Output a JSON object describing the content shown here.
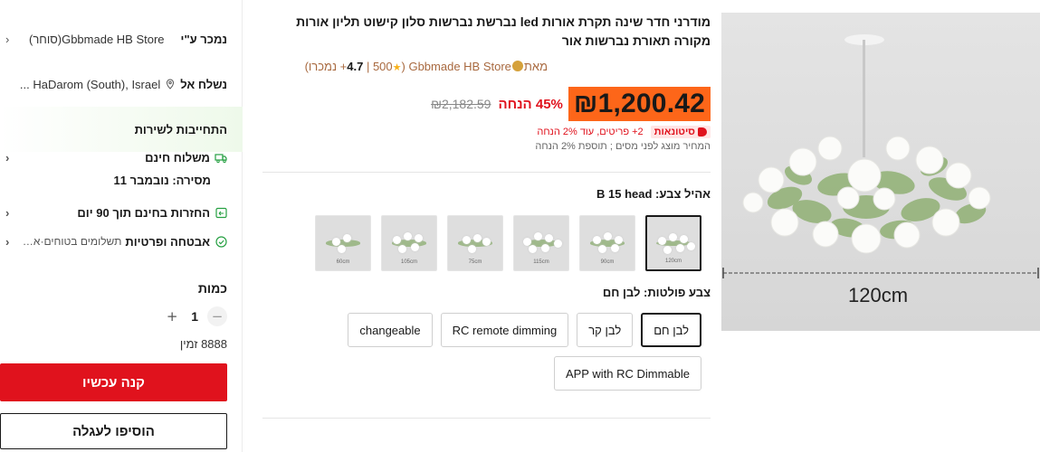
{
  "left": {
    "seller_label": "נמכר ע\"י",
    "seller_store": "Gbbmade HB Store(סוחר)",
    "ship_label": "נשלח אל",
    "ship_location": "HaDarom (South), Israel ...",
    "service_title": "התחייבות לשירות",
    "free_shipping": "משלוח חינם",
    "delivery": "מסירה: נובמבר 11",
    "returns": "החזרות בחינם תוך 90 יום",
    "security_title": "אבטחה ופרטיות",
    "security_sub": "תשלומים בטוחים·אבט...",
    "quantity_label": "כמות",
    "quantity_value": "1",
    "qty_minus": "−",
    "qty_plus": "+",
    "stock": "8888 זמין",
    "buy_now": "קנה עכשיו",
    "add_to_cart": "הוסיפו לעגלה",
    "chevron": "‹"
  },
  "product": {
    "title": "מודרני חדר שינה תקרת אורות led נברשת נברשות סלון קישוט תליון אורות מקורה תאורת נברשות אור",
    "store_name": "Gbbmade HB Store",
    "store_suffix": "מאת",
    "rating": "4.7",
    "sold": "500+ נמכרו",
    "price": "₪1,200.42",
    "discount": "45% הנחה",
    "original_price": "₪2,182.59",
    "promo_badge": "סיטונאות",
    "promo_text": "2+ פריטים, עוד 2% הנחה",
    "tax_note": "המחיר מוצג לפני מסים ; תוספת 2% הנחה",
    "color_label": "אהיל צבע: B 15 head",
    "thumbnails": [
      {
        "caption": "120cm",
        "selected": true
      },
      {
        "caption": "90cm",
        "selected": false
      },
      {
        "caption": "115cm",
        "selected": false
      },
      {
        "caption": "75cm",
        "selected": false
      },
      {
        "caption": "105cm",
        "selected": false
      },
      {
        "caption": "60cm",
        "selected": false
      }
    ],
    "temp_label": "צבע פולטות: לבן חם",
    "options": [
      "לבן חם",
      "לבן קר",
      "RC remote dimming",
      "changeable",
      "APP with RC Dimmable"
    ],
    "selected_option": "לבן חם",
    "image_size_label": "120cm"
  },
  "colors": {
    "accent_red": "#e0121d",
    "price_highlight": "#fd6619",
    "store_brown": "#a8693f",
    "rating_star": "#f8b018",
    "icon_green": "#26a042"
  }
}
